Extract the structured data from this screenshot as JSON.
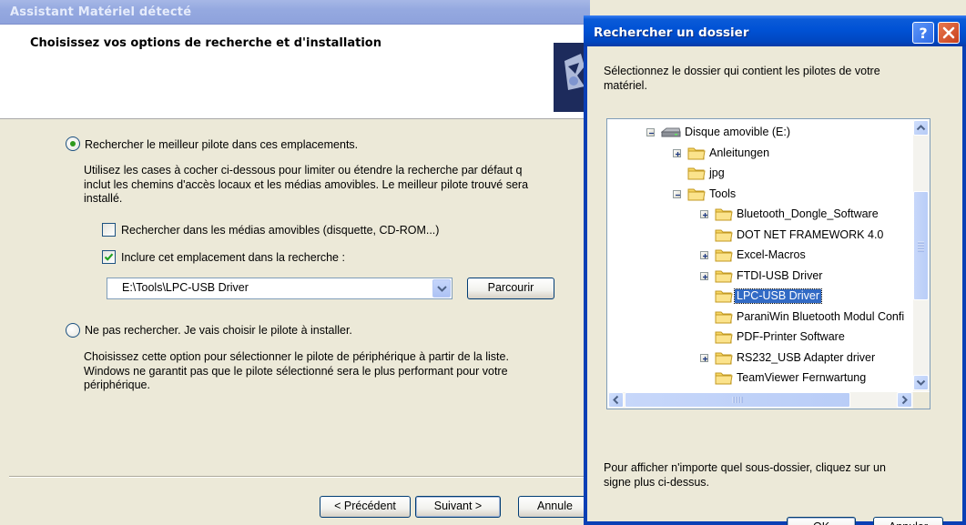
{
  "wizard": {
    "title": "Assistant Matériel détecté",
    "heading": "Choisissez vos options de recherche et d'installation",
    "option_search_label": "Rechercher le meilleur pilote dans ces emplacements.",
    "option_search_desc": [
      "Utilisez les cases à cocher ci-dessous pour limiter ou étendre la recherche par défaut q",
      "inclut les chemins d'accès locaux et les médias amovibles. Le meilleur pilote trouvé sera",
      "installé."
    ],
    "checkbox_removable_label": "Rechercher dans les médias amovibles (disquette, CD-ROM...)",
    "checkbox_removable_checked": false,
    "checkbox_include_label": "Inclure cet emplacement dans la recherche :",
    "checkbox_include_checked": true,
    "location_value": "E:\\Tools\\LPC-USB Driver",
    "browse_label": "Parcourir",
    "option_manual_label": "Ne pas rechercher. Je vais choisir le pilote à installer.",
    "option_manual_desc": [
      "Choisissez cette option pour sélectionner le pilote de périphérique à partir de la liste.",
      "Windows ne garantit pas que le pilote sélectionné sera le plus performant pour votre",
      "périphérique."
    ],
    "selected_option": "search",
    "back_label": "< Précédent",
    "next_label": "Suivant >",
    "cancel_label": "Annule"
  },
  "dialog": {
    "title": "Rechercher un dossier",
    "help_label": "?",
    "prompt": [
      "Sélectionnez le dossier qui contient les pilotes de votre",
      "matériel."
    ],
    "tree": [
      {
        "label": "Disque amovible (E:)",
        "level": 0,
        "icon": "drive-icon",
        "expander": "minus"
      },
      {
        "label": "Anleitungen",
        "level": 1,
        "icon": "folder-icon",
        "expander": "plus"
      },
      {
        "label": "jpg",
        "level": 1,
        "icon": "folder-icon",
        "expander": "none"
      },
      {
        "label": "Tools",
        "level": 1,
        "icon": "folder-icon",
        "expander": "minus"
      },
      {
        "label": "Bluetooth_Dongle_Software",
        "level": 2,
        "icon": "folder-icon",
        "expander": "plus"
      },
      {
        "label": "DOT NET FRAMEWORK 4.0",
        "level": 2,
        "icon": "folder-icon",
        "expander": "none"
      },
      {
        "label": "Excel-Macros",
        "level": 2,
        "icon": "folder-icon",
        "expander": "plus"
      },
      {
        "label": "FTDI-USB Driver",
        "level": 2,
        "icon": "folder-icon",
        "expander": "plus"
      },
      {
        "label": "LPC-USB Driver",
        "level": 2,
        "icon": "folder-icon",
        "expander": "none",
        "selected": true
      },
      {
        "label": "ParaniWin Bluetooth Modul Confi",
        "level": 2,
        "icon": "folder-icon",
        "expander": "none"
      },
      {
        "label": "PDF-Printer Software",
        "level": 2,
        "icon": "folder-icon",
        "expander": "none"
      },
      {
        "label": "RS232_USB Adapter driver",
        "level": 2,
        "icon": "folder-icon",
        "expander": "plus"
      },
      {
        "label": "TeamViewer Fernwartung",
        "level": 2,
        "icon": "folder-icon",
        "expander": "none"
      }
    ],
    "hint": [
      "Pour afficher n'importe quel sous-dossier, cliquez sur un",
      "signe plus ci-dessus."
    ],
    "ok_label": "OK",
    "cancel_label": "Annuler"
  },
  "colors": {
    "xp_title_active": "#0052d5",
    "xp_title_inactive": "#95a9e0",
    "selection": "#316ac5",
    "face": "#ece9d8"
  }
}
